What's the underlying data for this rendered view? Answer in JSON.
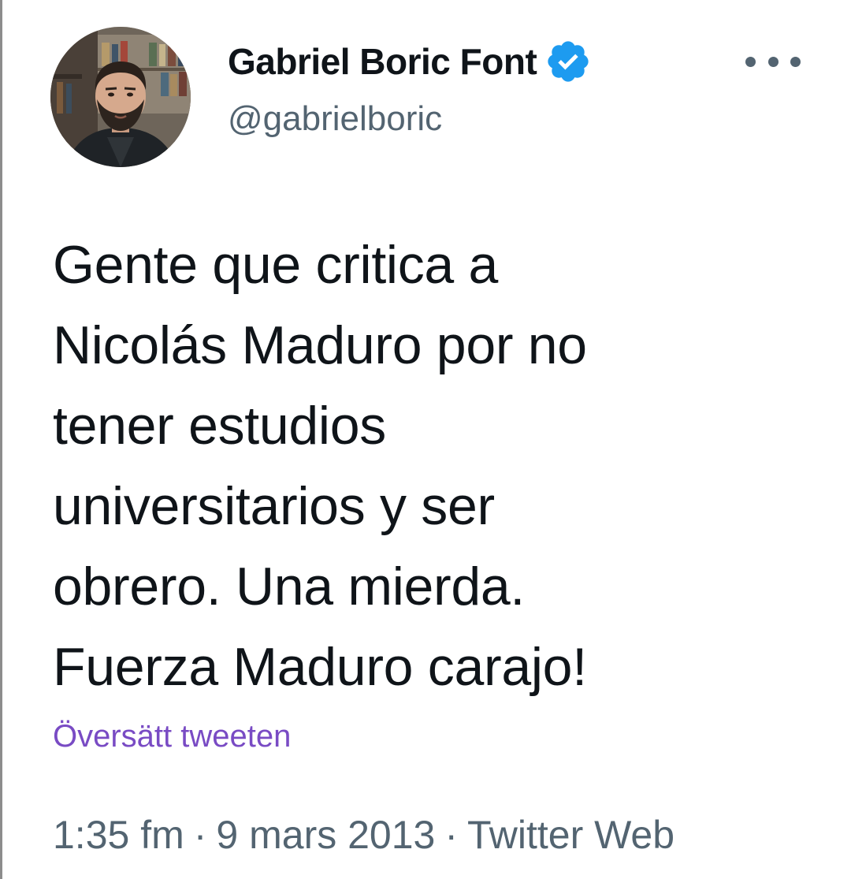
{
  "author": {
    "display_name": "Gabriel Boric Font",
    "handle": "@gabrielboric",
    "verified": true,
    "avatar_icon": "profile-photo",
    "verified_icon": "verified-badge-icon"
  },
  "more_icon": "more-dots-icon",
  "tweet": {
    "lines": [
      "Gente que critica a",
      "Nicolás Maduro por no",
      "tener estudios",
      "universitarios y ser",
      "obrero. Una mierda.",
      "Fuerza Maduro carajo!"
    ]
  },
  "translate_label": "Översätt tweeten",
  "meta": {
    "time": "1:35 fm",
    "date": "9 mars 2013",
    "source": "Twitter Web",
    "separator": "·"
  },
  "colors": {
    "text": "#0f1419",
    "secondary": "#536471",
    "translate": "#794bc4",
    "verified": "#1d9bf0"
  }
}
